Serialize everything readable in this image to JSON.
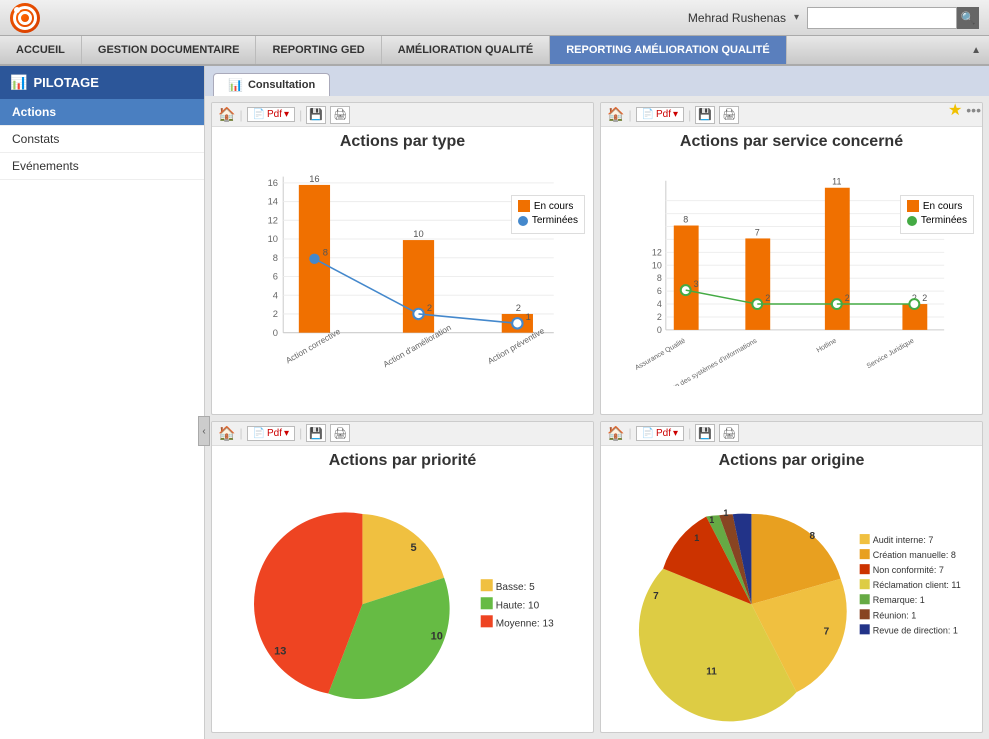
{
  "topbar": {
    "user_name": "Mehrad Rushenas",
    "search_placeholder": "",
    "search_icon": "🔍"
  },
  "nav": {
    "items": [
      {
        "label": "ACCUEIL",
        "active": false
      },
      {
        "label": "GESTION DOCUMENTAIRE",
        "active": false
      },
      {
        "label": "REPORTING GED",
        "active": false
      },
      {
        "label": "AMÉLIORATION QUALITÉ",
        "active": false
      },
      {
        "label": "REPORTING AMÉLIORATION QUALITÉ",
        "active": true
      }
    ]
  },
  "sidebar": {
    "header": "PILOTAGE",
    "items": [
      {
        "label": "Actions",
        "active": true
      },
      {
        "label": "Constats",
        "active": false
      },
      {
        "label": "Evénements",
        "active": false
      }
    ]
  },
  "tab": {
    "label": "Consultation"
  },
  "charts": {
    "chart1": {
      "title": "Actions par type",
      "legend": [
        {
          "label": "En cours",
          "color": "#f07000"
        },
        {
          "label": "Terminées",
          "color": "#4488cc",
          "shape": "circle"
        }
      ],
      "bars": [
        {
          "label": "Action corrective",
          "en_cours": 16,
          "terminees": 8
        },
        {
          "label": "Action d'amélioration",
          "en_cours": 10,
          "terminees": 2
        },
        {
          "label": "Action préventive",
          "en_cours": 2,
          "terminees": 1
        }
      ],
      "max": 18
    },
    "chart2": {
      "title": "Actions par service concerné",
      "legend": [
        {
          "label": "En cours",
          "color": "#f07000"
        },
        {
          "label": "Terminées",
          "color": "#44aa44",
          "shape": "circle"
        }
      ],
      "bars": [
        {
          "label": "Assurance Qualité",
          "en_cours": 8,
          "terminees": 3
        },
        {
          "label": "Direction des systèmes d'informations",
          "en_cours": 7,
          "terminees": 2
        },
        {
          "label": "Hotline",
          "en_cours": 11,
          "terminees": 2
        },
        {
          "label": "Service Juridique",
          "en_cours": 2,
          "terminees": 2
        }
      ],
      "max": 12
    },
    "chart3": {
      "title": "Actions par priorité",
      "legend": [
        {
          "label": "Basse: 5",
          "color": "#f0c040"
        },
        {
          "label": "Haute: 10",
          "color": "#66bb44"
        },
        {
          "label": "Moyenne: 13",
          "color": "#ee4422"
        }
      ],
      "segments": [
        {
          "label": "5",
          "value": 5,
          "color": "#f0c040"
        },
        {
          "label": "10",
          "value": 10,
          "color": "#66bb44"
        },
        {
          "label": "13",
          "value": 13,
          "color": "#ee4422"
        }
      ]
    },
    "chart4": {
      "title": "Actions par origine",
      "legend": [
        {
          "label": "Audit interne: 7",
          "color": "#f0c040"
        },
        {
          "label": "Création manuelle: 8",
          "color": "#e8a020"
        },
        {
          "label": "Non conformité: 7",
          "color": "#cc3300"
        },
        {
          "label": "Réclamation client: 11",
          "color": "#ddcc44"
        },
        {
          "label": "Remarque: 1",
          "color": "#66aa44"
        },
        {
          "label": "Réunion: 1",
          "color": "#884422"
        },
        {
          "label": "Revue de direction: 1",
          "color": "#223388"
        }
      ],
      "segments": [
        {
          "label": "8",
          "value": 8,
          "color": "#e8a020"
        },
        {
          "label": "7",
          "value": 7,
          "color": "#f0c040"
        },
        {
          "label": "11",
          "value": 11,
          "color": "#ddcc44"
        },
        {
          "label": "7",
          "value": 7,
          "color": "#cc3300"
        },
        {
          "label": "1",
          "value": 1,
          "color": "#66aa44"
        },
        {
          "label": "1",
          "value": 1,
          "color": "#884422"
        },
        {
          "label": "1",
          "value": 1,
          "color": "#223388"
        }
      ]
    }
  },
  "toolbar": {
    "pdf_label": "Pdf",
    "home_icon": "🏠",
    "star_icon": "★",
    "dots_icon": "•••"
  }
}
